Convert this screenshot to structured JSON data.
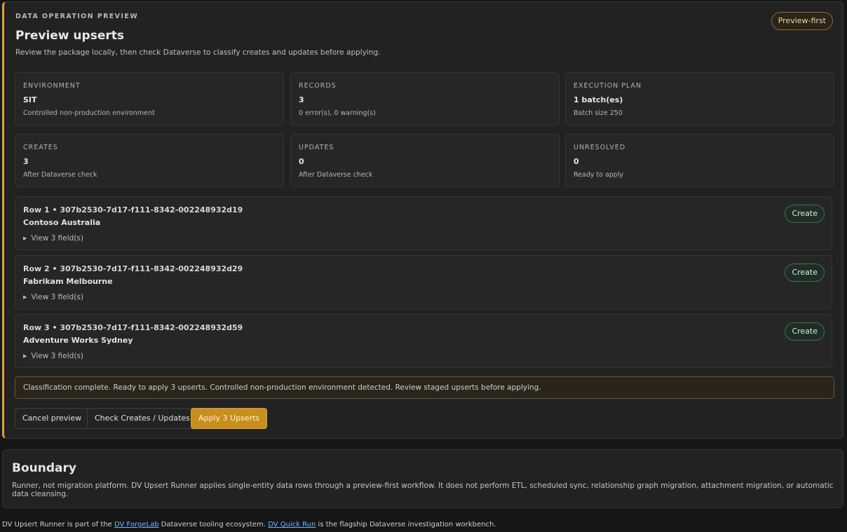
{
  "header": {
    "eyebrow": "DATA OPERATION PREVIEW",
    "title": "Preview upserts",
    "subtitle": "Review the package locally, then check Dataverse to classify creates and updates before applying.",
    "mode_badge": "Preview-first"
  },
  "stats": [
    {
      "label": "ENVIRONMENT",
      "value": "SIT",
      "sub": "Controlled non-production environment"
    },
    {
      "label": "RECORDS",
      "value": "3",
      "sub": "0 error(s), 0 warning(s)"
    },
    {
      "label": "EXECUTION PLAN",
      "value": "1 batch(es)",
      "sub": "Batch size 250"
    },
    {
      "label": "CREATES",
      "value": "3",
      "sub": "After Dataverse check"
    },
    {
      "label": "UPDATES",
      "value": "0",
      "sub": "After Dataverse check"
    },
    {
      "label": "UNRESOLVED",
      "value": "0",
      "sub": "Ready to apply"
    }
  ],
  "rows": [
    {
      "heading": "Row 1 • 307b2530-7d17-f111-8342-002248932d19",
      "name": "Contoso Australia",
      "fields": "View 3 field(s)",
      "action": "Create"
    },
    {
      "heading": "Row 2 • 307b2530-7d17-f111-8342-002248932d29",
      "name": "Fabrikam Melbourne",
      "fields": "View 3 field(s)",
      "action": "Create"
    },
    {
      "heading": "Row 3 • 307b2530-7d17-f111-8342-002248932d59",
      "name": "Adventure Works Sydney",
      "fields": "View 3 field(s)",
      "action": "Create"
    }
  ],
  "notice": "Classification complete. Ready to apply 3 upserts. Controlled non-production environment detected. Review staged upserts before applying.",
  "actions": {
    "cancel": "Cancel preview",
    "check": "Check Creates / Updates",
    "apply": "Apply 3 Upserts"
  },
  "boundary": {
    "title": "Boundary",
    "text": "Runner, not migration platform. DV Upsert Runner applies single-entity data rows through a preview-first workflow. It does not perform ETL, scheduled sync, relationship graph migration, attachment migration, or automatic data cleansing."
  },
  "footer": {
    "part1": "DV Upsert Runner is part of the ",
    "link1": "DV ForgeLab",
    "part2": " Dataverse tooling ecosystem. ",
    "link2": "DV Quick Run",
    "part3": " is the flagship Dataverse investigation workbench."
  },
  "colors": {
    "accent": "#d9a23a",
    "primary_button": "#c88f1f",
    "create_badge_border": "#3f6f53",
    "link": "#6fb6ff"
  }
}
